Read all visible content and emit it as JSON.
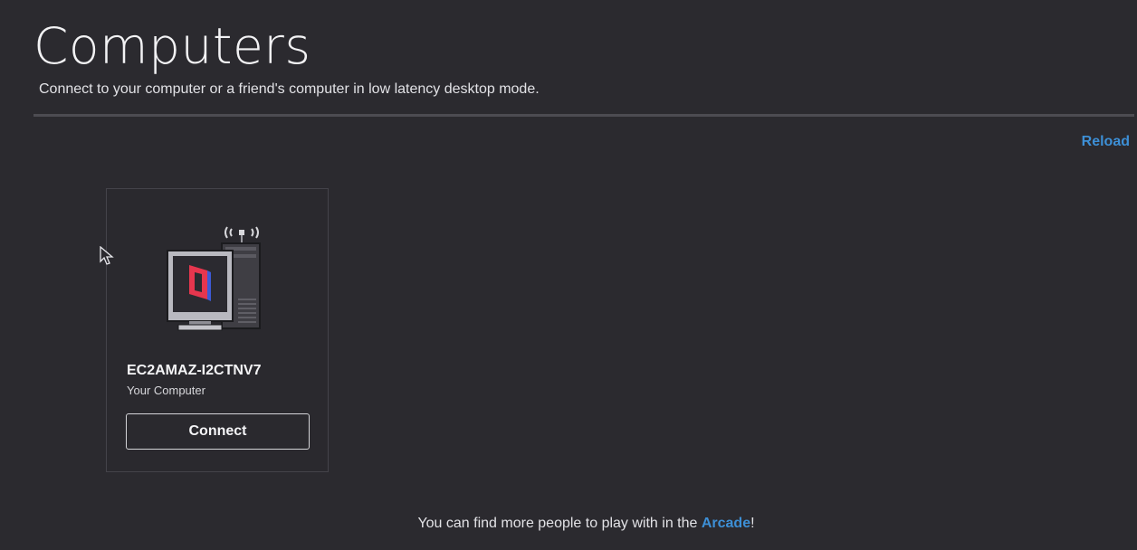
{
  "page": {
    "title": "Computers",
    "subtitle": "Connect to your computer or a friend's computer in low latency desktop mode.",
    "reload_label": "Reload"
  },
  "computers": [
    {
      "name": "EC2AMAZ-I2CTNV7",
      "subtitle": "Your Computer",
      "connect_label": "Connect",
      "icon": "computer-tower-icon"
    }
  ],
  "footer": {
    "prefix": "You can find more people to play with in the ",
    "link_label": "Arcade",
    "suffix": "!"
  },
  "colors": {
    "background": "#2b2a2f",
    "accent": "#3d8fd6",
    "logo_red": "#e6364e",
    "logo_blue": "#3d5ad6"
  }
}
